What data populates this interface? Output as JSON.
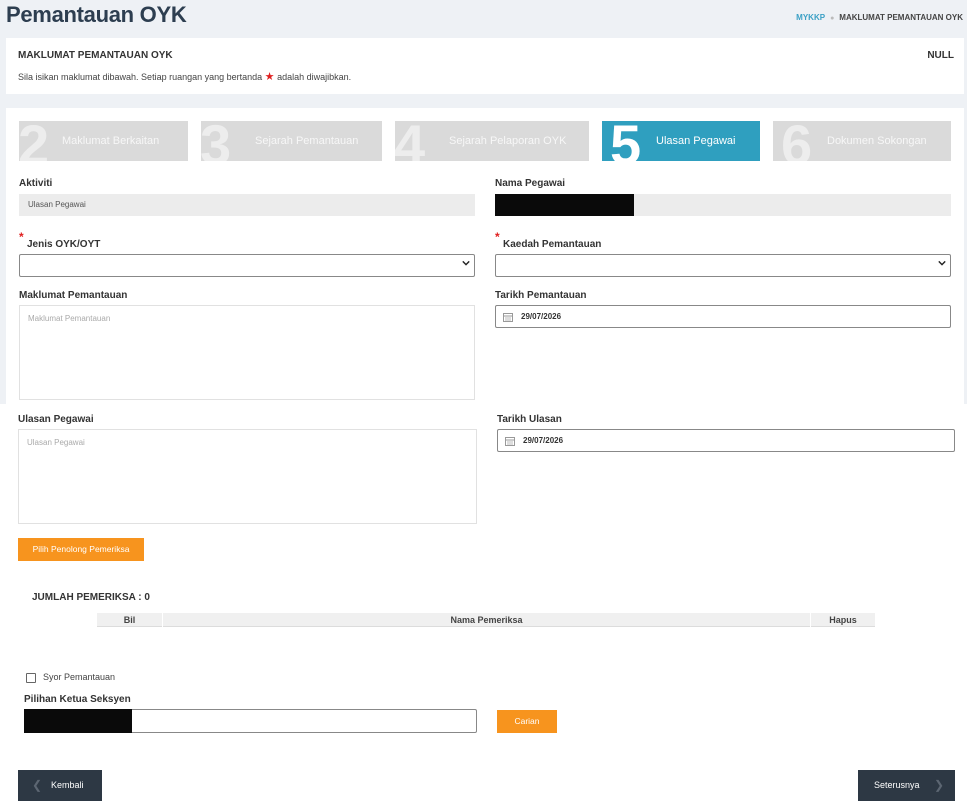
{
  "header": {
    "title": "Pemantauan OYK",
    "breadcrumb": {
      "home": "MYKKP",
      "current": "MAKLUMAT PEMANTAUAN OYK"
    }
  },
  "info_card": {
    "title": "MAKLUMAT PEMANTAUAN OYK",
    "status": "NULL",
    "desc_before": "Sila isikan maklumat dibawah. Setiap ruangan yang bertanda",
    "desc_after": "adalah diwajibkan."
  },
  "steps": [
    {
      "num": "2",
      "label": "Maklumat Berkaitan",
      "active": false
    },
    {
      "num": "3",
      "label": "Sejarah Pemantauan",
      "active": false
    },
    {
      "num": "4",
      "label": "Sejarah Pelaporan OYK",
      "active": false
    },
    {
      "num": "5",
      "label": "Ulasan Pegawai",
      "active": true
    },
    {
      "num": "6",
      "label": "Dokumen Sokongan",
      "active": false
    }
  ],
  "form": {
    "aktiviti": {
      "label": "Aktiviti",
      "value": "Ulasan Pegawai"
    },
    "nama_pegawai": {
      "label": "Nama Pegawai"
    },
    "jenis_oyk": {
      "label": "Jenis OYK/OYT",
      "required_mark": "*",
      "value": ""
    },
    "kaedah": {
      "label": "Kaedah Pemantauan",
      "required_mark": "*",
      "value": ""
    },
    "maklumat": {
      "label": "Maklumat Pemantauan",
      "placeholder": "Maklumat Pemantauan"
    },
    "tarikh_pemantauan": {
      "label": "Tarikh Pemantauan",
      "value": "29/07/2026"
    },
    "ulasan": {
      "label": "Ulasan Pegawai",
      "placeholder": "Ulasan Pegawai"
    },
    "tarikh_ulasan": {
      "label": "Tarikh Ulasan",
      "value": "29/07/2026"
    }
  },
  "pilih_button": "Pilih Penolong Pemeriksa",
  "jumlah": "JUMLAH PEMERIKSA : 0",
  "table": {
    "columns": [
      "Bil",
      "Nama Pemeriksa",
      "Hapus"
    ]
  },
  "syor": {
    "label": "Syor Pemantauan",
    "checked": false
  },
  "ketua": {
    "label": "Pilihan Ketua Seksyen"
  },
  "carian_button": "Carian",
  "nav": {
    "back": "Kembali",
    "next": "Seterusnya"
  },
  "colors": {
    "accent_teal": "#2f9fbf",
    "orange": "#f7941e",
    "required_red": "#e02020",
    "dark_button": "#2d3844"
  }
}
